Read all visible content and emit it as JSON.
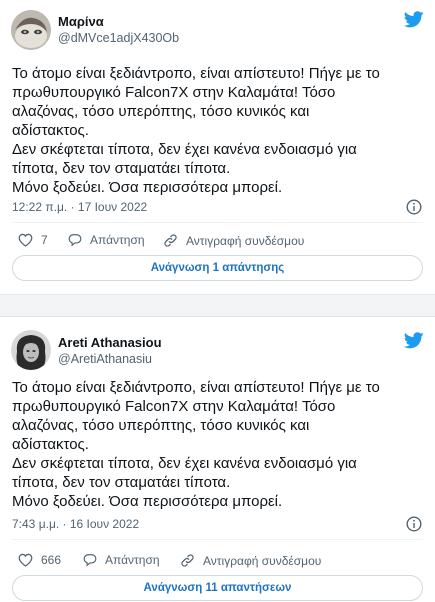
{
  "colors": {
    "accent": "#1d9bf0",
    "link": "#1d74c4",
    "muted": "#536471",
    "gap": "#f2f4f5"
  },
  "tweets": [
    {
      "name": "Μαρίνα",
      "handle": "@dMVce1adjX430Ob",
      "text_lines": [
        "Το άτομο είναι ξεδιάντροπο, είναι απίστευτο! Πήγε με το",
        "πρωθυπουργικό Falcon7X στην Καλαμάτα! Τόσο",
        "αλαζόνας, τόσο υπερόπτης, τόσο κυνικός και",
        "αδίστακτος.",
        "Δεν σκέφτεται τίποτα, δεν έχει κανένα ενδοιασμό για",
        "τίποτα,  δεν τον σταματάει τίποτα.",
        "Μόνο ξοδεύει. Όσα περισσότερα μπορεί."
      ],
      "timestamp": "12:22 π.μ. · 17 Ιουν 2022",
      "like_count": "7",
      "reply_label": "Απάντηση",
      "copy_link_label": "Αντιγραφή συνδέσμου",
      "read_replies_label": "Ανάγνωση 1 απάντησης",
      "icons": {
        "brand": "twitter-bird-icon",
        "info": "info-icon",
        "like": "heart-icon",
        "reply": "reply-bubble-icon",
        "link": "link-icon"
      }
    },
    {
      "name": "Areti Athanasiou",
      "handle": "@AretiAthanasiu",
      "text_lines": [
        "Το άτομο είναι ξεδιάντροπο, είναι απίστευτο! Πήγε με το",
        "πρωθυπουργικό Falcon7X στην Καλαμάτα! Τόσο",
        "αλαζόνας, τόσο υπερόπτης, τόσο κυνικός και",
        "αδίστακτος.",
        "Δεν σκέφτεται τίποτα, δεν έχει κανένα ενδοιασμό για",
        "τίποτα,  δεν τον σταματάει τίποτα.",
        "Μόνο ξοδεύει. Όσα περισσότερα μπορεί."
      ],
      "timestamp": "7:43 μ.μ. · 16 Ιουν 2022",
      "like_count": "666",
      "reply_label": "Απάντηση",
      "copy_link_label": "Αντιγραφή συνδέσμου",
      "read_replies_label": "Ανάγνωση 11 απαντήσεων",
      "icons": {
        "brand": "twitter-bird-icon",
        "info": "info-icon",
        "like": "heart-icon",
        "reply": "reply-bubble-icon",
        "link": "link-icon"
      }
    }
  ]
}
